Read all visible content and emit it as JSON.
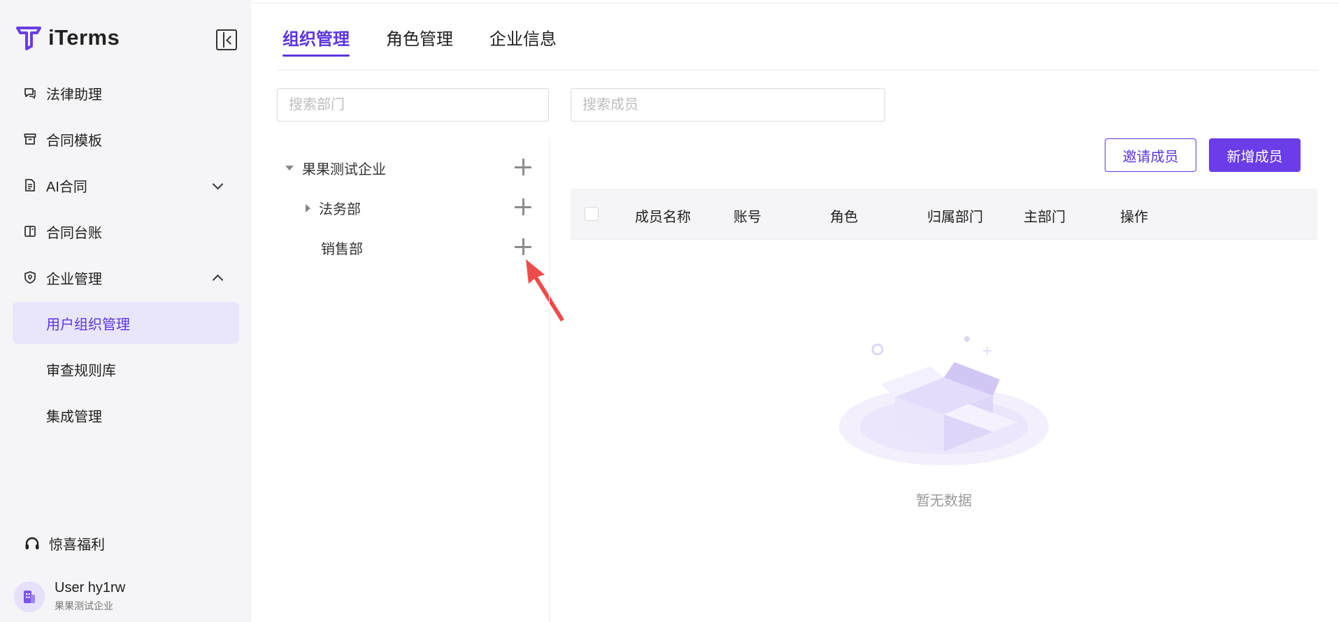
{
  "app": {
    "brand": "iTerms",
    "accent": "#5b35e0",
    "primary_button_color": "#6a3de8"
  },
  "sidebar": {
    "items": [
      {
        "label": "法律助理",
        "icon": "chat-bubble-icon"
      },
      {
        "label": "合同模板",
        "icon": "archive-box-icon"
      },
      {
        "label": "AI合同",
        "icon": "document-icon",
        "expanded": false
      },
      {
        "label": "合同台账",
        "icon": "ledger-book-icon"
      },
      {
        "label": "企业管理",
        "icon": "shield-icon",
        "expanded": true
      }
    ],
    "subitems": [
      {
        "label": "用户组织管理",
        "active": true
      },
      {
        "label": "审查规则库",
        "active": false
      },
      {
        "label": "集成管理",
        "active": false
      }
    ],
    "benefit_label": "惊喜福利",
    "user": {
      "name": "User hy1rw",
      "org": "果果测试企业"
    }
  },
  "tabs": [
    {
      "label": "组织管理",
      "active": true
    },
    {
      "label": "角色管理",
      "active": false
    },
    {
      "label": "企业信息",
      "active": false
    }
  ],
  "search": {
    "dept_placeholder": "搜索部门",
    "member_placeholder": "搜索成员"
  },
  "tree": {
    "root": "果果测试企业",
    "children": [
      {
        "label": "法务部",
        "has_children": true
      },
      {
        "label": "销售部",
        "has_children": false
      }
    ]
  },
  "buttons": {
    "invite": "邀请成员",
    "add": "新增成员"
  },
  "table": {
    "columns": [
      "成员名称",
      "账号",
      "角色",
      "归属部门",
      "主部门",
      "操作"
    ],
    "rows": []
  },
  "empty_text": "暂无数据"
}
